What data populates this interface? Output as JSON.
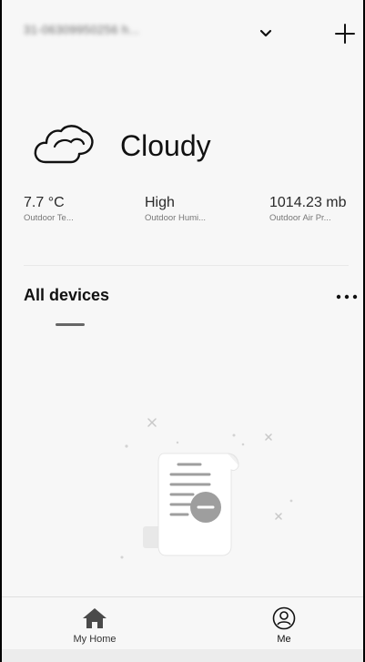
{
  "header": {
    "home_name": "31-06309950256 h...",
    "dropdown_icon": "chevron-down-icon",
    "add_icon": "plus-icon"
  },
  "weather": {
    "icon": "cloud-icon",
    "condition": "Cloudy",
    "stats": [
      {
        "value": "7.7 °C",
        "label": "Outdoor Te..."
      },
      {
        "value": "High",
        "label": "Outdoor Humi..."
      },
      {
        "value": "1014.23 mb",
        "label": "Outdoor Air Pr..."
      }
    ]
  },
  "devices": {
    "title": "All devices",
    "more_icon": "more-dots-icon",
    "empty_illustration": "empty-document-icon"
  },
  "bottom_nav": {
    "items": [
      {
        "label": "My Home",
        "icon": "home-icon"
      },
      {
        "label": "Me",
        "icon": "user-circle-icon"
      }
    ]
  }
}
